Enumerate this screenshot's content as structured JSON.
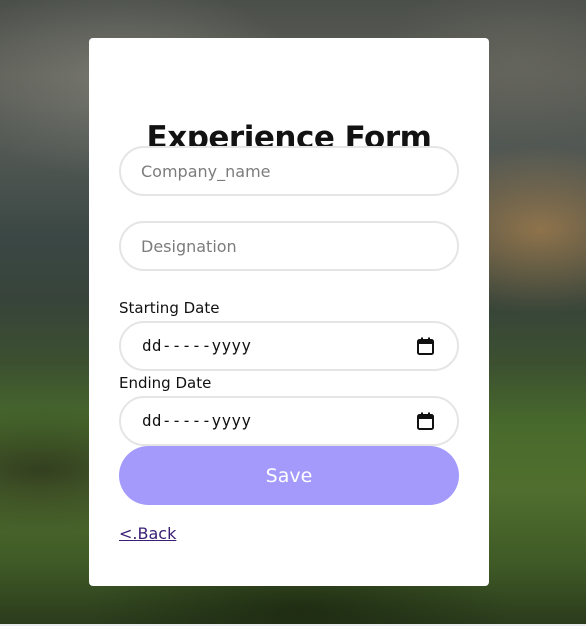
{
  "form": {
    "title": "Experience Form",
    "company_placeholder": "Company_name",
    "designation_placeholder": "Designation",
    "starting_date_label": "Starting Date",
    "starting_date_value": "dd-----yyyy",
    "ending_date_label": "Ending Date",
    "ending_date_value": "dd-----yyyy",
    "calendar_icon": "calendar-icon",
    "save_label": "Save",
    "back_label": "<.Back"
  },
  "colors": {
    "save_button": "#a39afc",
    "back_link": "#3a1e74",
    "card": "#ffffff",
    "field_border": "#e5e5e5"
  }
}
